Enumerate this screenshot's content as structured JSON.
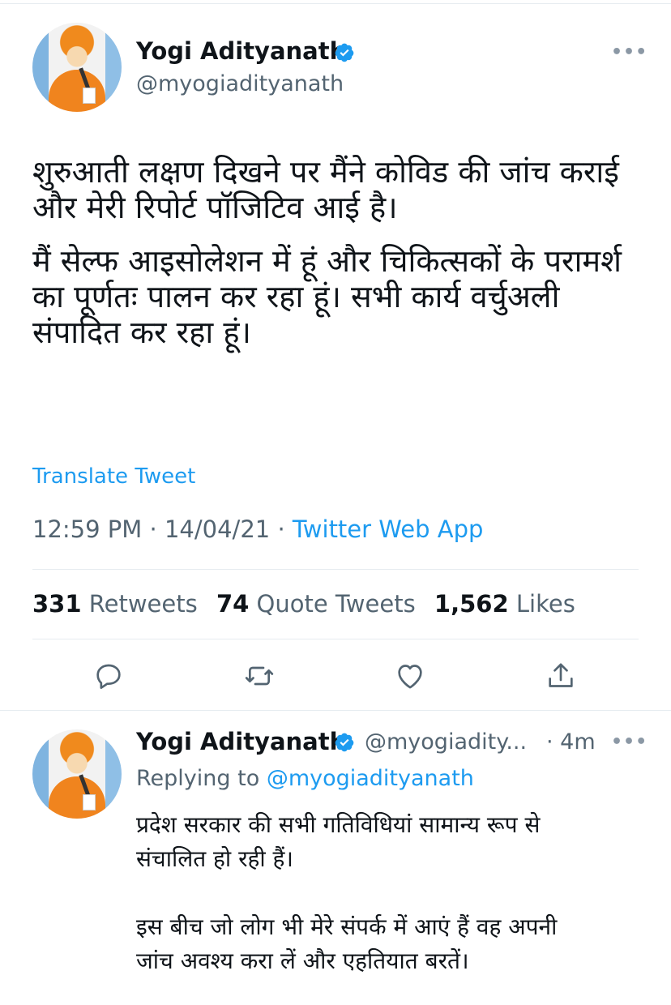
{
  "main_tweet": {
    "author_name": "Yogi Adityanath",
    "author_handle": "@myogiadityanath",
    "paragraphs": [
      "शुरुआती लक्षण दिखने पर मैंने कोविड की जांच कराई और मेरी रिपोर्ट पॉजिटिव आई है।",
      "मैं सेल्फ आइसोलेशन में हूं और चिकित्सकों के परामर्श का पूर्णतः पालन कर रहा हूं। सभी कार्य वर्चुअली संपादित कर रहा हूं।"
    ],
    "translate_label": "Translate Tweet",
    "time": "12:59 PM",
    "date": "14/04/21",
    "source": "Twitter Web App",
    "retweets_count": "331",
    "retweets_label": "Retweets",
    "quote_count": "74",
    "quote_label": "Quote Tweets",
    "likes_count": "1,562",
    "likes_label": "Likes"
  },
  "reply_tweet": {
    "author_name": "Yogi Adityanath",
    "author_handle": "@myogiadity...",
    "age": "· 4m",
    "replying_prefix": "Replying to",
    "replying_handle": "@myogiadityanath",
    "lines": [
      "प्रदेश सरकार की सभी गतिविधियां सामान्य रूप से",
      "संचालित हो रही हैं।",
      "इस बीच जो लोग भी मेरे संपर्क में आएं हैं वह अपनी",
      "जांच अवश्य करा लें और एहतियात बरतें।"
    ]
  },
  "icons": {
    "verified": "verified-badge-icon",
    "more": "more-dots-icon",
    "reply": "reply-icon",
    "retweet": "retweet-icon",
    "like": "heart-icon",
    "share": "share-icon"
  },
  "colors": {
    "accent": "#1d9bf0",
    "text": "#0f1419",
    "secondary": "#536471"
  }
}
